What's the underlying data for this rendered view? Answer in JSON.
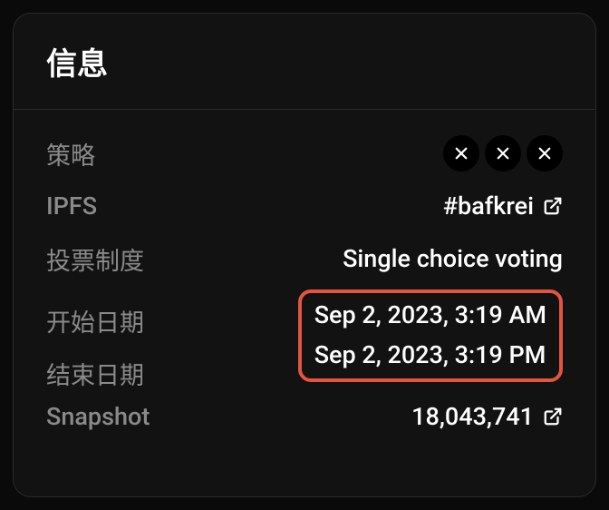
{
  "header": {
    "title": "信息"
  },
  "rows": {
    "strategy": {
      "label": "策略"
    },
    "ipfs": {
      "label": "IPFS",
      "value": "#bafkrei"
    },
    "voting_system": {
      "label": "投票制度",
      "value": "Single choice voting"
    },
    "start_date": {
      "label": "开始日期",
      "value": "Sep 2, 2023, 3:19 AM"
    },
    "end_date": {
      "label": "结束日期",
      "value": "Sep 2, 2023, 3:19 PM"
    },
    "snapshot": {
      "label": "Snapshot",
      "value": "18,043,741"
    }
  }
}
